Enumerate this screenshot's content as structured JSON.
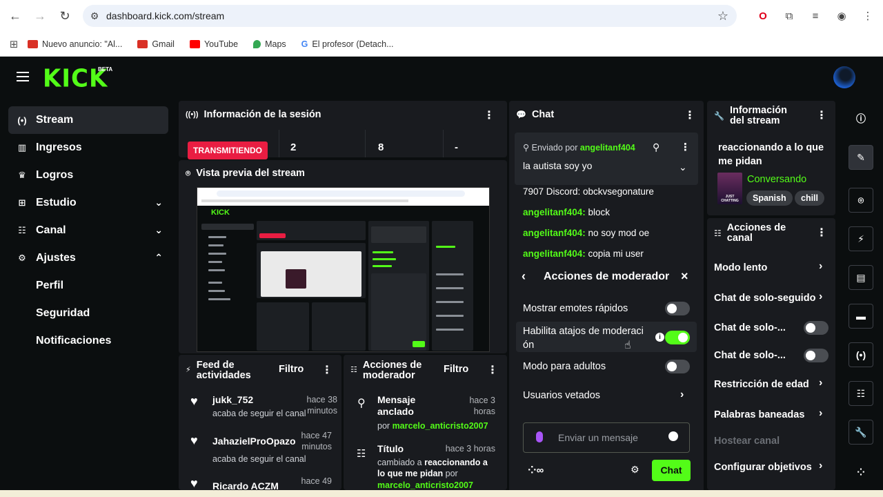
{
  "browser": {
    "url": "dashboard.kick.com/stream",
    "bookmarks": [
      {
        "label": "Nuevo anuncio: \"Al...",
        "icon": "gmail-icon",
        "color": "#d93025"
      },
      {
        "label": "Gmail",
        "icon": "gmail-icon",
        "color": "#d93025"
      },
      {
        "label": "YouTube",
        "icon": "youtube-icon",
        "color": "#ff0000"
      },
      {
        "label": "Maps",
        "icon": "maps-icon",
        "color": "#34a853"
      },
      {
        "label": "El profesor (Detach...",
        "icon": "google-icon",
        "color": "#4285f4"
      }
    ]
  },
  "header": {
    "logo": "KICK",
    "beta": "BETA",
    "accent": "#53fc18"
  },
  "sidebar": {
    "items": [
      {
        "label": "Stream",
        "icon": "broadcast-icon"
      },
      {
        "label": "Ingresos",
        "icon": "chart-icon"
      },
      {
        "label": "Logros",
        "icon": "trophy-icon"
      },
      {
        "label": "Estudio",
        "icon": "grid-icon"
      },
      {
        "label": "Canal",
        "icon": "channel-icon"
      },
      {
        "label": "Ajustes",
        "icon": "gear-icon"
      }
    ],
    "sub_items": [
      "Perfil",
      "Seguridad",
      "Notificaciones"
    ]
  },
  "session": {
    "title": "Información de la sesión",
    "status": "TRANSMITIENDO",
    "stats": [
      "2",
      "8",
      "-"
    ]
  },
  "preview": {
    "title": "Vista previa del stream"
  },
  "feed": {
    "title": "Feed de actividades",
    "filter": "Filtro",
    "items": [
      {
        "user": "jukk_752",
        "time": "hace 38 minutos",
        "action": "acaba de seguir el canal"
      },
      {
        "user": "JahazielProOpazo",
        "time": "hace 47 minutos",
        "action": "acaba de seguir el canal"
      },
      {
        "user": "Ricardo ACZM",
        "time": "hace 49"
      }
    ]
  },
  "mod_actions": {
    "title": "Acciones de moderador",
    "filter": "Filtro",
    "items": [
      {
        "title": "Mensaje anclado",
        "time": "hace 3 horas",
        "by": "por",
        "user": "marcelo_anticristo2007"
      },
      {
        "title": "Título",
        "time": "hace 3 horas",
        "desc": "cambiado a",
        "value": "reaccionando a lo que me pidan",
        "by": "por",
        "user": "marcelo_anticristo2007"
      }
    ]
  },
  "chat": {
    "title": "Chat",
    "pinned": {
      "prefix": "Enviado por",
      "user": "angelitanf404",
      "message": "la autista soy yo"
    },
    "messages": [
      {
        "user": "",
        "text": "7907 Discord: obckvsegonature"
      },
      {
        "user": "angelitanf404:",
        "text": "block"
      },
      {
        "user": "angelitanf404:",
        "text": "no soy mod oe"
      },
      {
        "user": "angelitanf404:",
        "text": "copia mi user"
      }
    ],
    "mod_panel": {
      "title": "Acciones de moderador",
      "rows": [
        {
          "label": "Mostrar emotes rápidos",
          "toggle": false
        },
        {
          "label": "Habilita atajos de moderaci ón",
          "toggle": true
        },
        {
          "label": "Modo para adultos",
          "toggle": false
        },
        {
          "label": "Usuarios vetados",
          "toggle": null
        }
      ]
    },
    "input_placeholder": "Enviar un mensaje",
    "send_label": "Chat"
  },
  "stream_info": {
    "title": "Información del stream",
    "stream_title": "reaccionando a lo que me pidan",
    "category": "Conversando",
    "tags": [
      "Spanish",
      "chill"
    ],
    "thumb_text": "JUST CHATTING"
  },
  "channel_actions": {
    "title": "Acciones de canal",
    "rows": [
      {
        "label": "Modo lento",
        "type": "arrow"
      },
      {
        "label": "Chat de solo-seguido",
        "type": "arrow"
      },
      {
        "label": "Chat de solo-...",
        "type": "toggle"
      },
      {
        "label": "Chat de solo-...",
        "type": "toggle"
      },
      {
        "label": "Restricción de edad",
        "type": "arrow"
      },
      {
        "label": "Palabras baneadas",
        "type": "arrow"
      },
      {
        "label": "Hostear canal",
        "type": "disabled"
      },
      {
        "label": "Configurar objetivos",
        "type": "arrow"
      }
    ]
  }
}
